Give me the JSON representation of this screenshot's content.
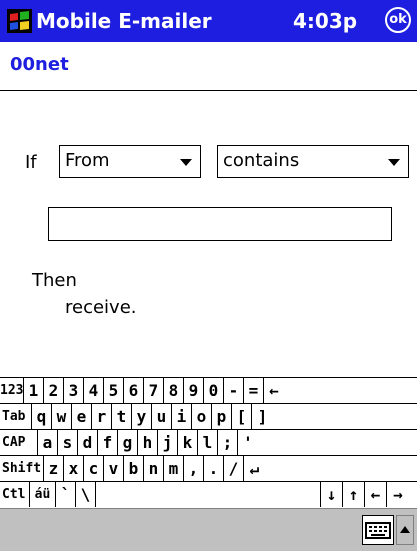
{
  "titlebar": {
    "app_title": "Mobile E-mailer",
    "clock": "4:03p",
    "ok_label": "ok"
  },
  "account": {
    "name": "00net"
  },
  "rule": {
    "if_label": "If",
    "field_select": "From",
    "operator_select": "contains",
    "value_input": "",
    "then_label": "Then",
    "action_text": "receive."
  },
  "keyboard": {
    "rows": [
      [
        "123",
        "1",
        "2",
        "3",
        "4",
        "5",
        "6",
        "7",
        "8",
        "9",
        "0",
        "-",
        "=",
        "←"
      ],
      [
        "Tab",
        "q",
        "w",
        "e",
        "r",
        "t",
        "y",
        "u",
        "i",
        "o",
        "p",
        "[",
        "]"
      ],
      [
        "CAP",
        "a",
        "s",
        "d",
        "f",
        "g",
        "h",
        "j",
        "k",
        "l",
        ";",
        "'"
      ],
      [
        "Shift",
        "z",
        "x",
        "c",
        "v",
        "b",
        "n",
        "m",
        ",",
        ".",
        "/",
        "↵"
      ],
      [
        "Ctl",
        "áü",
        "`",
        "\\",
        " ",
        "↓",
        "↑",
        "←",
        "→"
      ]
    ]
  },
  "icons": {
    "start": "windows-flag-icon",
    "keyboard_toggle": "keyboard-icon",
    "sip_arrow": "up-arrow-icon"
  },
  "colors": {
    "titlebar": "#1e1ee0",
    "account": "#1e1ee0",
    "bottombar": "#c0c0c0"
  }
}
